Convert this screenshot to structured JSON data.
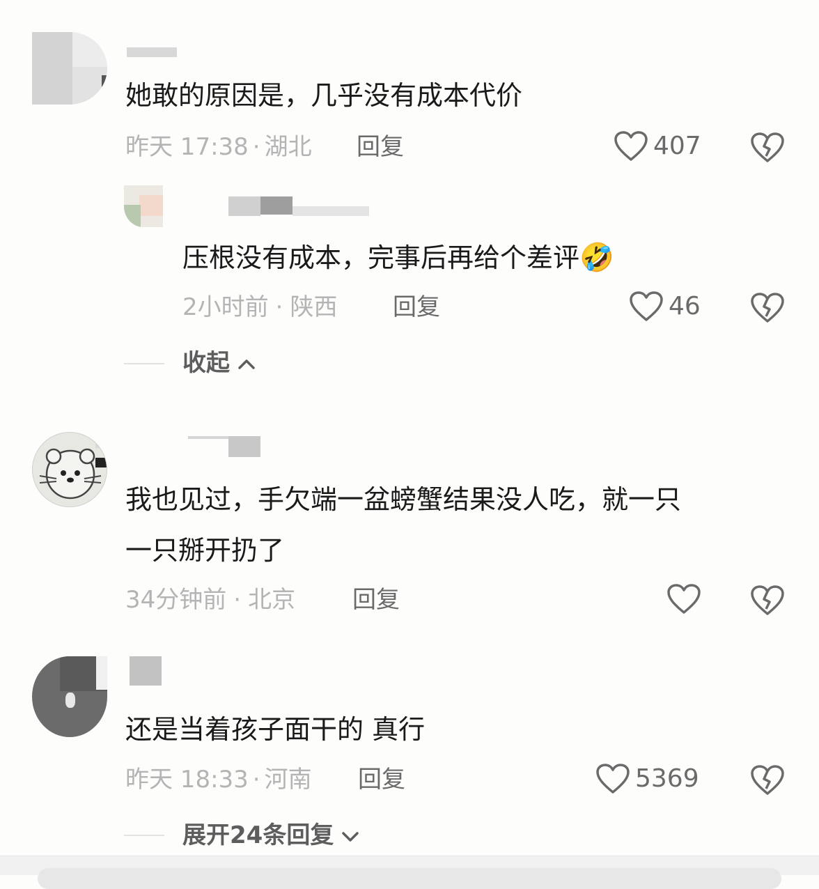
{
  "comments": [
    {
      "username": "",
      "text": "她敢的原因是，几乎没有成本代价",
      "time": "昨天 17:38",
      "location": "湖北",
      "reply_label": "回复",
      "likes": "407"
    },
    {
      "username": "",
      "text": "压根没有成本，完事后再给个差评",
      "emoji": "🤣",
      "time": "2小时前",
      "location": "陕西",
      "reply_label": "回复",
      "likes": "46"
    },
    {
      "username": "",
      "text_line1": "我也见过，手欠端一盆螃蟹结果没人吃，就一只",
      "text_line2": "一只掰开扔了",
      "time": "34分钟前",
      "location": "北京",
      "reply_label": "回复",
      "likes": ""
    },
    {
      "username": "",
      "text": "还是当着孩子面干的 真行",
      "time": "昨天 18:33",
      "location": "河南",
      "reply_label": "回复",
      "likes": "5369"
    }
  ],
  "collapse_label": "收起",
  "expand_label": "展开24条回复",
  "meta_separator": "·",
  "icons": {
    "like": "heart-outline-icon",
    "dislike": "broken-heart-icon",
    "collapse": "chevron-up-icon",
    "expand": "chevron-down-icon"
  },
  "colors": {
    "text": "#1a1a1a",
    "meta": "#b4b4b4",
    "action": "#6a6a6a"
  }
}
